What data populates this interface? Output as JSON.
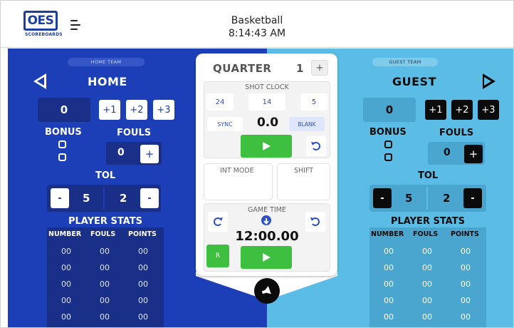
{
  "header": {
    "logo_text": "OES",
    "logo_sub": "SCOREBOARDS",
    "title": "Basketball",
    "time": "8:14:43 AM"
  },
  "home": {
    "pill": "HOME TEAM",
    "name": "HOME",
    "score": "0",
    "plus1": "+1",
    "plus2": "+2",
    "plus3": "+3",
    "bonus_label": "BONUS",
    "fouls_label": "FOULS",
    "fouls": "0",
    "fouls_plus": "+",
    "tol_label": "TOL",
    "tol_minus": "-",
    "tol_full": "5",
    "tol_partial": "2",
    "stats_label": "PLAYER STATS",
    "columns": [
      "NUMBER",
      "FOULS",
      "POINTS"
    ],
    "rows": [
      [
        "00",
        "00",
        "00"
      ],
      [
        "00",
        "00",
        "00"
      ],
      [
        "00",
        "00",
        "00"
      ],
      [
        "00",
        "00",
        "00"
      ],
      [
        "00",
        "00",
        "00"
      ]
    ]
  },
  "guest": {
    "pill": "GUEST TEAM",
    "name": "GUEST",
    "score": "0",
    "plus1": "+1",
    "plus2": "+2",
    "plus3": "+3",
    "bonus_label": "BONUS",
    "fouls_label": "FOULS",
    "fouls": "0",
    "fouls_plus": "+",
    "tol_label": "TOL",
    "tol_minus": "-",
    "tol_full": "5",
    "tol_partial": "2",
    "stats_label": "PLAYER STATS",
    "columns": [
      "NUMBER",
      "FOULS",
      "POINTS"
    ],
    "rows": [
      [
        "00",
        "00",
        "00"
      ],
      [
        "00",
        "00",
        "00"
      ],
      [
        "00",
        "00",
        "00"
      ],
      [
        "00",
        "00",
        "00"
      ],
      [
        "00",
        "00",
        "00"
      ]
    ]
  },
  "center": {
    "quarter_label": "QUARTER",
    "quarter_value": "1",
    "quarter_plus": "+",
    "shot_clock_label": "SHOT CLOCK",
    "shot_presets": [
      "24",
      "14",
      "5"
    ],
    "sync_label": "SYNC",
    "shot_value": "0.0",
    "blank_label": "BLANK",
    "int_mode_label": "INT MODE",
    "shift_label": "SHIFT",
    "game_time_label": "GAME TIME",
    "game_time_value": "12:00.00",
    "r_label": "R"
  },
  "colors": {
    "home_bg": "#1c3fb8",
    "guest_bg": "#5bbde6",
    "play_green": "#3fbf3f",
    "dark": "#0b0b0b"
  },
  "icons": [
    "menu-icon",
    "left-arrow-icon",
    "right-arrow-icon",
    "play-icon",
    "reset-icon",
    "redo-icon",
    "down-arrow-icon",
    "horn-icon"
  ]
}
